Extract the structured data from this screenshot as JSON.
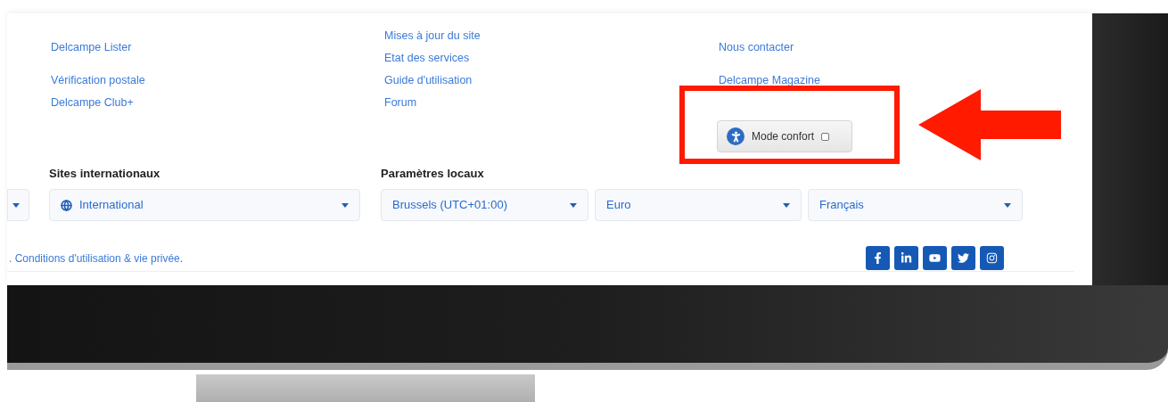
{
  "link_columns": [
    {
      "groups": [
        [
          "Delcampe Lister"
        ],
        [
          "Vérification postale",
          "Delcampe Club+"
        ]
      ]
    },
    {
      "groups": [
        [
          "Mises à jour du site",
          "Etat des services",
          "Guide d'utilisation",
          "Forum"
        ]
      ]
    },
    {
      "groups": [
        [
          "Nous contacter"
        ],
        [
          "Delcampe Magazine"
        ]
      ]
    }
  ],
  "comfort_mode": {
    "label": "Mode confort",
    "checked": false
  },
  "international": {
    "heading": "Sites internationaux",
    "selects": [
      {
        "kind": "cut"
      },
      {
        "kind": "globe",
        "value": "International"
      }
    ]
  },
  "local_settings": {
    "heading": "Paramètres locaux",
    "selects": [
      {
        "kind": "plain",
        "value": "Brussels (UTC+01:00)"
      },
      {
        "kind": "plain",
        "value": "Euro"
      },
      {
        "kind": "plain",
        "value": "Français"
      }
    ]
  },
  "footer": {
    "legal_link": ". Conditions d'utilisation & vie privée.",
    "social": [
      {
        "kind": "facebook"
      },
      {
        "kind": "linkedin"
      },
      {
        "kind": "youtube"
      },
      {
        "kind": "twitter"
      },
      {
        "kind": "instagram"
      }
    ]
  }
}
